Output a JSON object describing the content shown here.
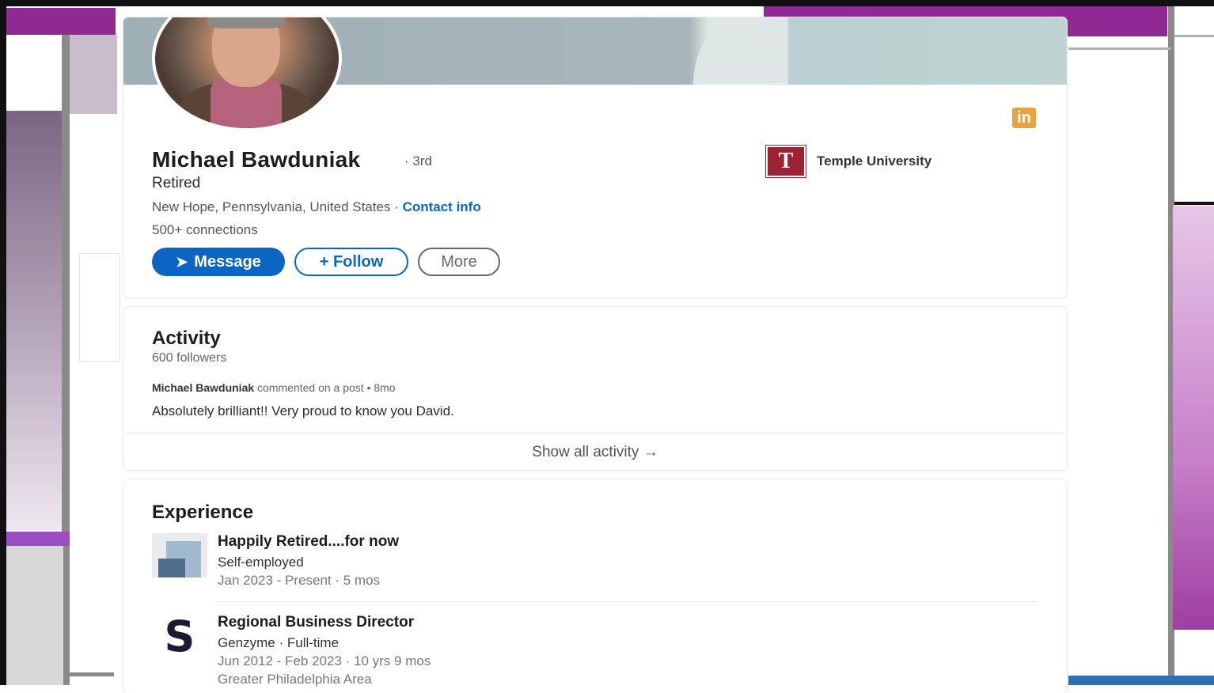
{
  "profile": {
    "name": "Michael Bawduniak",
    "degree": "· 3rd",
    "headline": "Retired",
    "location": "New Hope, Pennsylvania, United States ·",
    "contact_info": "Contact info",
    "connections": "500+ connections",
    "education": "Temple University",
    "linkedin_badge": "in",
    "school_logo": "T"
  },
  "actions": {
    "message": "Message",
    "message_icon": "➤",
    "follow": "+ Follow",
    "more": "More"
  },
  "activity": {
    "title": "Activity",
    "followers": "600 followers",
    "post_author": "Michael Bawduniak",
    "post_meta": "commented on a post • 8mo",
    "post_text": "Absolutely brilliant!! Very proud to know you David.",
    "show_all": "Show all activity →"
  },
  "experience": {
    "title": "Experience",
    "items": [
      {
        "title": "Happily Retired....for now",
        "company": "Self-employed",
        "dates": "Jan 2023 - Present · 5 mos"
      },
      {
        "title": "Regional Business Director",
        "company": "Genzyme · Full-time",
        "dates": "Jun 2012 - Feb 2023 · 10 yrs 9 mos",
        "location": "Greater Philadelphia Area",
        "logo_glyph": "S"
      }
    ]
  },
  "colors": {
    "primary_blue": "#0a66c2",
    "temple_red": "#9d2235",
    "linkedin_badge": "#e8a33d",
    "frame_purple": "#8e2a91"
  }
}
